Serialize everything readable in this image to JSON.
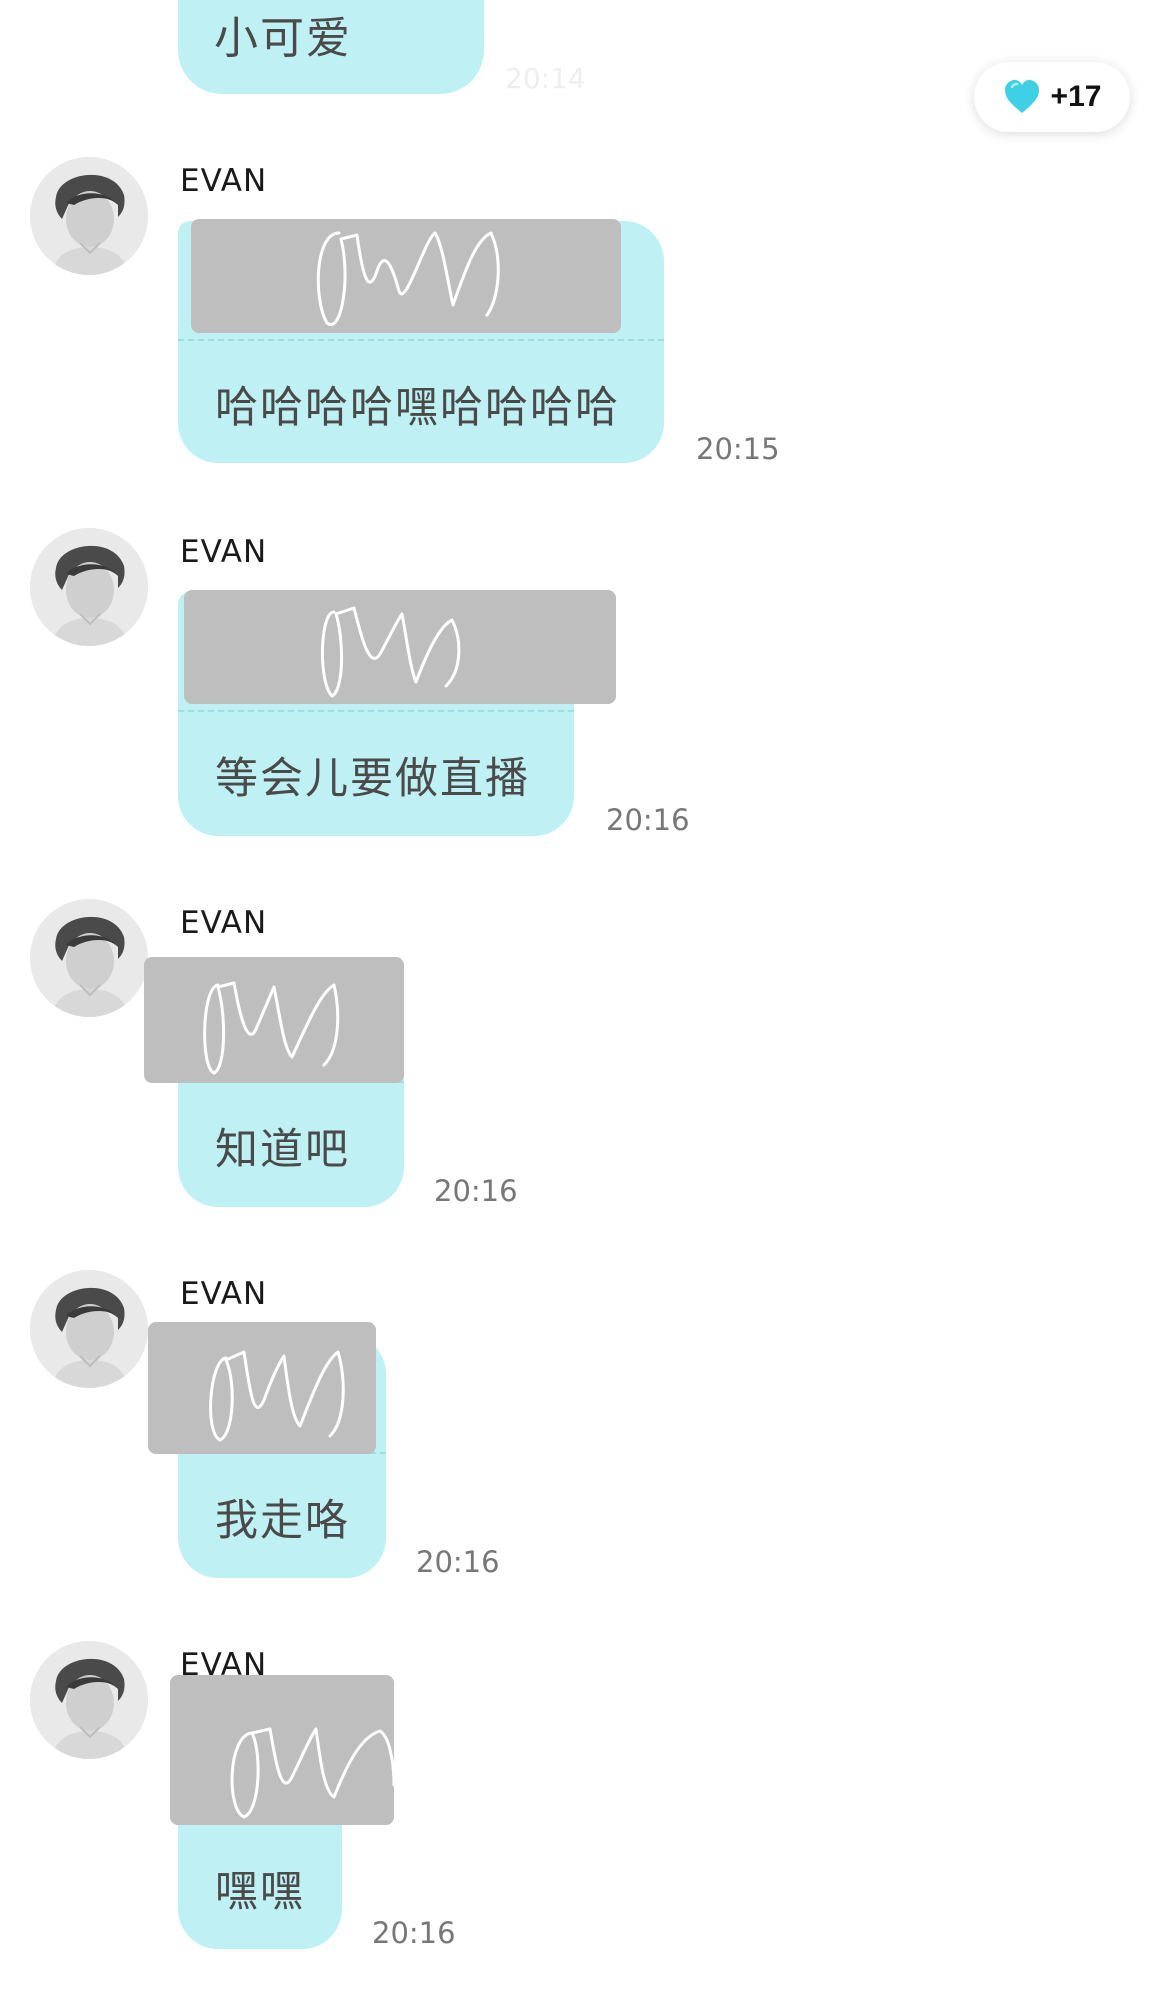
{
  "top_message": {
    "text": "小可爱",
    "time": "20:14"
  },
  "heart_badge": {
    "icon": "heart-icon",
    "color": "#3fd0e6",
    "count": "+17"
  },
  "colors": {
    "bubble": "#bff1f4",
    "redaction": "#bebebe",
    "time": "#777777"
  },
  "messages": [
    {
      "sender": "EVAN",
      "text": "哈哈哈哈嘿哈哈哈哈",
      "time": "20:15"
    },
    {
      "sender": "EVAN",
      "text": "等会儿要做直播",
      "time": "20:16"
    },
    {
      "sender": "EVAN",
      "text": "知道吧",
      "time": "20:16"
    },
    {
      "sender": "EVAN",
      "text": "我走咯",
      "time": "20:16"
    },
    {
      "sender": "EVAN",
      "text": "嘿嘿",
      "time": "20:16"
    }
  ]
}
